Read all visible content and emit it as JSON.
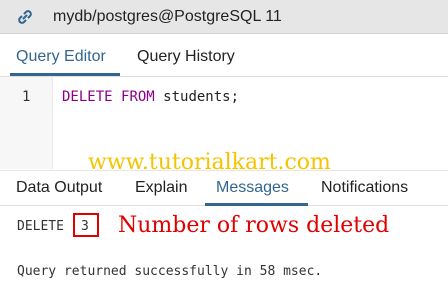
{
  "connection": {
    "title": "mydb/postgres@PostgreSQL 11",
    "icon": "link-icon"
  },
  "top_tabs": [
    {
      "label": "Query Editor",
      "active": true
    },
    {
      "label": "Query History",
      "active": false
    }
  ],
  "editor": {
    "line_number": "1",
    "keyword1": "DELETE",
    "keyword2": "FROM",
    "rest": " students;"
  },
  "watermark": "www.tutorialkart.com",
  "bottom_tabs": [
    {
      "label": "Data Output",
      "active": false
    },
    {
      "label": "Explain",
      "active": false
    },
    {
      "label": "Messages",
      "active": true
    },
    {
      "label": "Notifications",
      "active": false
    }
  ],
  "messages": {
    "command": "DELETE",
    "count": "3",
    "annotation": "Number of rows deleted",
    "status": "Query returned successfully in 58 msec."
  },
  "colors": {
    "accent": "#326690",
    "annotation": "#e00000",
    "watermark": "#f5c400"
  }
}
